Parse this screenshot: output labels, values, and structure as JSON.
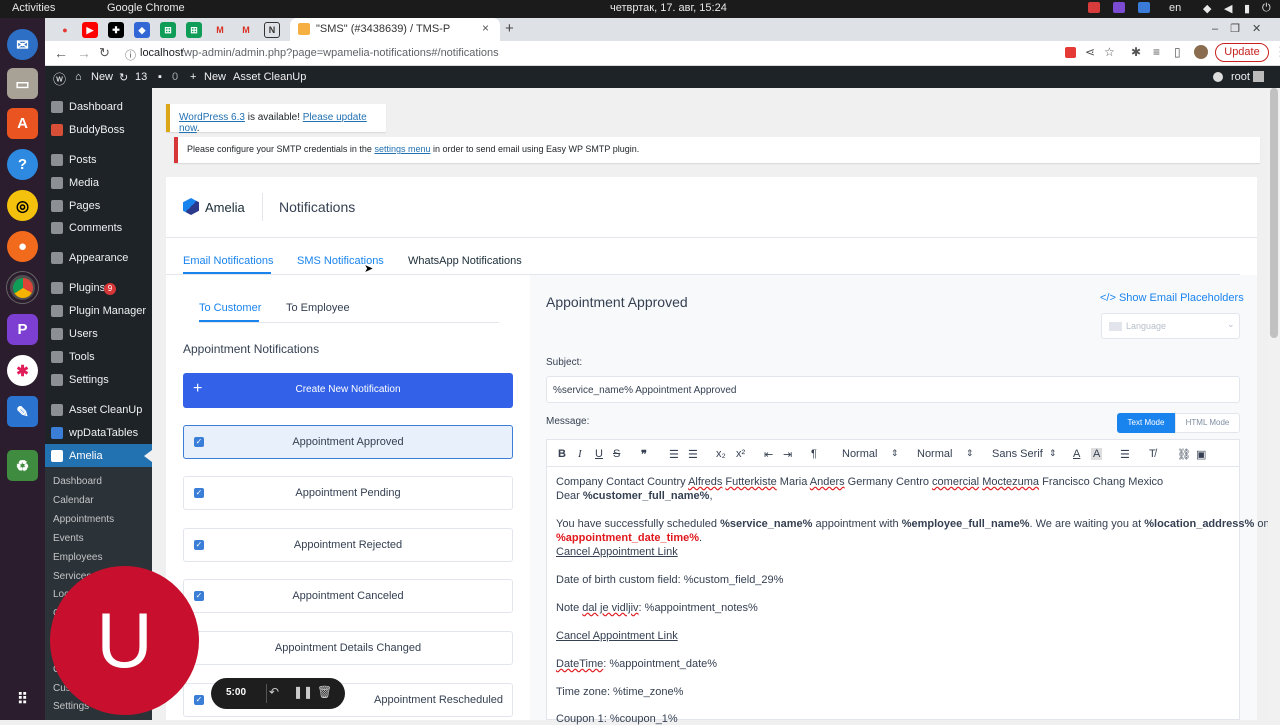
{
  "system": {
    "activities": "Activities",
    "app": "Google Chrome",
    "datetime": "четвртак, 17. авг, 15:24",
    "lang": "en"
  },
  "browser": {
    "tab_title": "\"SMS\" (#3438639) / TMS-P",
    "url_host": "localhost",
    "url_path": "/wp-admin/admin.php?page=wpamelia-notifications#/notifications",
    "update": "Update"
  },
  "adminbar": {
    "new_site": "New",
    "updates": "13",
    "comments": "0",
    "new": "New",
    "asset": "Asset CleanUp",
    "user": "root"
  },
  "sidebar": {
    "items": [
      "Dashboard",
      "BuddyBoss",
      "Posts",
      "Media",
      "Pages",
      "Comments",
      "Appearance",
      "Plugins",
      "Plugin Manager",
      "Users",
      "Tools",
      "Settings",
      "Asset CleanUp",
      "wpDataTables",
      "Amelia"
    ],
    "plugins_badge": "9",
    "sub": [
      "Dashboard",
      "Calendar",
      "Appointments",
      "Events",
      "Employees",
      "Services",
      "Loc",
      "C",
      "C",
      "Cus",
      "Settings"
    ]
  },
  "notices": {
    "wp_ver_link": "WordPress 6.3",
    "wp_mid": " is available! ",
    "wp_update": "Please update now",
    "wp_end": ".",
    "smtp_pre": "Please configure your SMTP credentials in the ",
    "smtp_link": "settings menu",
    "smtp_post": " in order to send email using Easy WP SMTP plugin."
  },
  "header": {
    "brand": "Amelia",
    "title": "Notifications"
  },
  "tabs": {
    "email": "Email Notifications",
    "sms": "SMS Notifications",
    "whatsapp": "WhatsApp Notifications"
  },
  "subtabs": {
    "customer": "To Customer",
    "employee": "To Employee"
  },
  "list": {
    "heading": "Appointment Notifications",
    "create": "Create New Notification",
    "items": [
      "Appointment Approved",
      "Appointment Pending",
      "Appointment Rejected",
      "Appointment Canceled",
      "Appointment Details Changed",
      "Appointment Rescheduled"
    ]
  },
  "editor": {
    "title": "Appointment Approved",
    "placeholders": "</> Show Email Placeholders",
    "language": "Language",
    "subject_label": "Subject:",
    "subject": "%service_name% Appointment Approved",
    "message_label": "Message:",
    "text_mode": "Text Mode",
    "html_mode": "HTML Mode",
    "tb_normal1": "Normal",
    "tb_normal2": "Normal",
    "tb_font": "Sans Serif",
    "l1a": "Company Contact Country ",
    "l1b": "Alfreds",
    "l1c": " ",
    "l1d": "Futterkiste",
    "l1e": " Maria ",
    "l1f": "Anders",
    "l1g": " Germany Centro ",
    "l1h": "comercial",
    "l1i": " ",
    "l1j": "Moctezuma",
    "l1k": " Francisco Chang Mexico",
    "l2a": "Dear ",
    "l2b": "%customer_full_name%",
    "l2c": ",",
    "l3a": "You have successfully scheduled ",
    "l3b": "%service_name%",
    "l3c": " appointment with ",
    "l3d": "%employee_full_name%",
    "l3e": ". We are waiting you at ",
    "l3f": "%location_address%",
    "l3g": " on",
    "l4": "%appointment_date_time%",
    "l4b": ".",
    "cancel1": "Cancel Appointment Link",
    "dob": "Date of birth custom field: %custom_field_29%",
    "note_a": "Note ",
    "note_b": "dal je vidljiv",
    "note_c": ": %appointment_notes%",
    "cancel2": "Cancel Appointment Link",
    "dt_a": "DateTime",
    "dt_b": ": %appointment_date%",
    "tz": "Time zone: %time_zone%",
    "coupon": "Coupon 1: %coupon_1%"
  },
  "recorder": {
    "time": "5:00"
  },
  "avatar": {
    "letter": "U"
  }
}
